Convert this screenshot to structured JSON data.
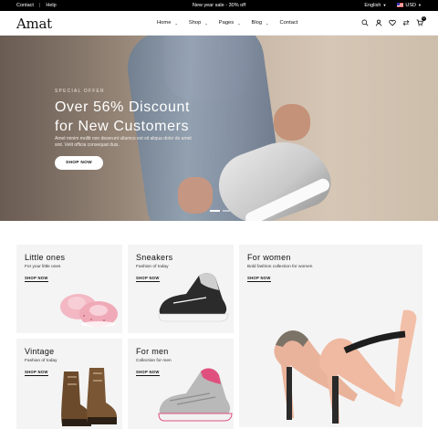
{
  "topbar": {
    "links": [
      "Contact",
      "Help"
    ],
    "promo": "New year sale - 30% off",
    "language": "English",
    "currency": "USD"
  },
  "header": {
    "logo": "Amat",
    "nav": [
      {
        "label": "Home",
        "dropdown": true
      },
      {
        "label": "Shop",
        "dropdown": true
      },
      {
        "label": "Pages",
        "dropdown": true
      },
      {
        "label": "Blog",
        "dropdown": true
      },
      {
        "label": "Contact",
        "dropdown": false
      }
    ],
    "icons": [
      "search-icon",
      "user-icon",
      "heart-icon",
      "compare-icon",
      "cart-icon"
    ],
    "cart_count": "0"
  },
  "hero": {
    "kicker": "SPECIAL OFFER",
    "title": "Over 56% Discount for New Customers",
    "description": "Amet minim mollit non deserunt ullamco est sit aliqua dolor do amet sint. Velit officia consequat duis.",
    "button": "SHOP NOW",
    "slides": 2,
    "active_slide": 1
  },
  "categories": [
    {
      "title": "Little ones",
      "subtitle": "For your little ones",
      "link": "SHOP NOW"
    },
    {
      "title": "Sneakers",
      "subtitle": "Fashion of today",
      "link": "SHOP NOW"
    },
    {
      "title": "For women",
      "subtitle": "Bold fashion collection for women",
      "link": "SHOP NOW"
    },
    {
      "title": "Vintage",
      "subtitle": "Fashion of today",
      "link": "SHOP NOW"
    },
    {
      "title": "For men",
      "subtitle": "Collection for men",
      "link": "SHOP NOW"
    }
  ]
}
